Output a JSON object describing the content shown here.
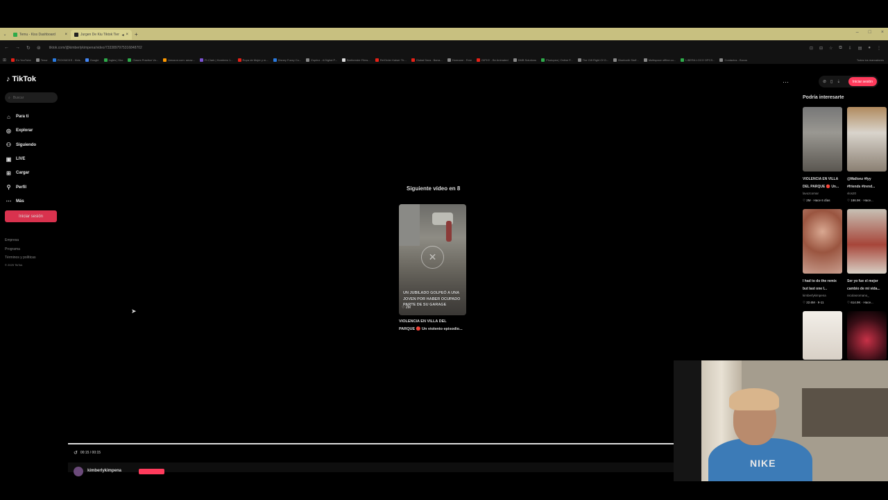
{
  "browser": {
    "tabs": [
      {
        "label": "Temu - Kiss Dashboard",
        "color": "#2eaa4a",
        "active": false
      },
      {
        "label": "Jurgen De Kiu Tiktok Tienda",
        "color": "#222222",
        "active": true
      }
    ],
    "url": "tiktok.com/@kimberlykimpena/video/7333897975316848702",
    "bookmarks": [
      {
        "label": "En YouTube",
        "color": "#e62117"
      },
      {
        "label": "Tenor",
        "color": "#888888"
      },
      {
        "label": "PICKNICKS - Kids",
        "color": "#2a7adf"
      },
      {
        "label": "Google",
        "color": "#4285f4"
      },
      {
        "label": "Ingles | Kko",
        "color": "#2eaa4a"
      },
      {
        "label": "Clases Practice Ve...",
        "color": "#2eaa4a"
      },
      {
        "label": "Amazon.com: amaz...",
        "color": "#ff9900"
      },
      {
        "label": "Pr Clark | Hombres 1...",
        "color": "#7a52d1"
      },
      {
        "label": "Ropa de Mujer y m...",
        "color": "#e62117"
      },
      {
        "label": "Disney Fuzzy Cu...",
        "color": "#2a7adf"
      },
      {
        "label": "Zsprinz - A Digital P...",
        "color": "#888888"
      },
      {
        "label": "Bretbender Films...",
        "color": "#dddddd"
      },
      {
        "label": "Re/Order Kaiser Th...",
        "color": "#e62117"
      },
      {
        "label": "Global Dara - Barra...",
        "color": "#e62117"
      },
      {
        "label": "Hormane - Free",
        "color": "#888888"
      },
      {
        "label": "GIPHY - Be Animated",
        "color": "#e62117"
      },
      {
        "label": "DMB Solutions",
        "color": "#888888"
      },
      {
        "label": "Photopea | Online P...",
        "color": "#2eaa4a"
      },
      {
        "label": "The Gift Right Of G...",
        "color": "#888888"
      },
      {
        "label": "Bluetooth Stuff...",
        "color": "#888888"
      },
      {
        "label": "Multispace offline.co...",
        "color": "#888888"
      },
      {
        "label": "LIBERA LOCO OPCS...",
        "color": "#2eaa4a"
      },
      {
        "label": "Contactos - Bucos",
        "color": "#888888"
      }
    ],
    "bookmarks_all": "Todos los marcadores"
  },
  "tiktok": {
    "logo": "TikTok",
    "search_placeholder": "Buscar",
    "nav": [
      {
        "label": "Para ti",
        "icon": "home-icon",
        "glyph": "⌂"
      },
      {
        "label": "Explorar",
        "icon": "compass-icon",
        "glyph": "◎"
      },
      {
        "label": "Siguiendo",
        "icon": "following-icon",
        "glyph": "⚇"
      },
      {
        "label": "LIVE",
        "icon": "live-icon",
        "glyph": "▣"
      },
      {
        "label": "Cargar",
        "icon": "upload-icon",
        "glyph": "⊞"
      },
      {
        "label": "Perfil",
        "icon": "profile-icon",
        "glyph": "⚲"
      },
      {
        "label": "Más",
        "icon": "more-icon",
        "glyph": "⋯"
      }
    ],
    "login_label": "Iniciar sesión",
    "footer": [
      "Empresa",
      "Programa",
      "Términos y políticas"
    ],
    "copyright": "© 2025 TikTok",
    "top_login": "Iniciar sesión"
  },
  "player": {
    "next_title": "Siguiente vídeo en 8",
    "thumb_overlay": "UN JUBILADO GOLPEÓ A UNA JOVEN POR HABER OCUPADO PARTE DE SU GARAGE",
    "thumb_likes": "♡ 2M",
    "caption_line1": "VIOLENCIA EN VILLA DEL",
    "caption_line2": "PARQUE 🔴 Un violento episodio...",
    "time": "00:15 / 00:15",
    "username": "kimberlykimpena",
    "progress": 1.0
  },
  "recommendations": {
    "title": "Podría interesarte",
    "items": [
      {
        "title1": "VIOLENCIA EN VILLA",
        "title2": "DEL PARQUE 🔴 Un...",
        "user": "lavozcomar",
        "stats": "♡ 2M · Hace 6 días"
      },
      {
        "title1": "@Mallonz #fyy",
        "title2": "#friends #trend...",
        "user": "vlos20",
        "stats": "♡ 186.9K · Hace..."
      },
      {
        "title1": "I had to do the remix",
        "title2": "but last one I...",
        "user": "kimberlykimpena",
        "stats": "♡ 22.6M · 9-11"
      },
      {
        "title1": "Ser yo fue el mejor",
        "title2": "cambio de mi vida...",
        "user": "nicolasromano_",
        "stats": "♡ 614.9K · Hace..."
      },
      {
        "title1": "",
        "title2": "",
        "user": "",
        "stats": ""
      },
      {
        "title1": "",
        "title2": "",
        "user": "",
        "stats": ""
      }
    ]
  },
  "webcam": {
    "shirt_logo": "NIKE"
  },
  "colors": {
    "accent": "#ff3b5c",
    "background": "#000000",
    "tabbar": "#c8c080"
  }
}
